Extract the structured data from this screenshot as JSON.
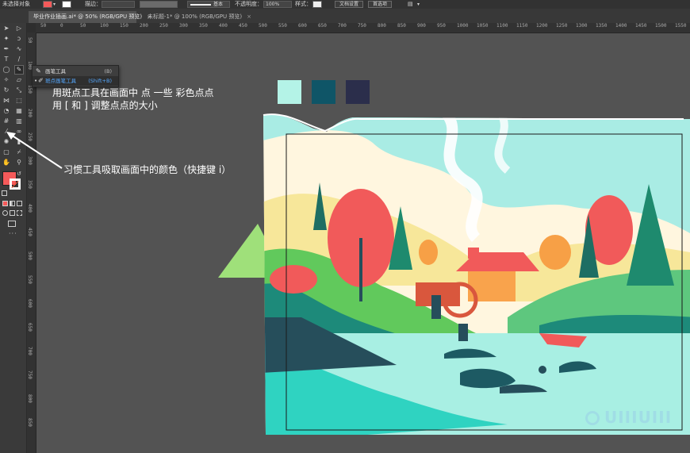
{
  "control_bar": {
    "selection_status": "未选择对象",
    "stroke_label": "描边：",
    "stroke_profile": "基本",
    "opacity_label": "不透明度：",
    "opacity_value": "100%",
    "style_label": "样式：",
    "doc_setup_button": "文档设置",
    "preferences_button": "首选项",
    "fill_color": "#f55a5a"
  },
  "tabs": [
    {
      "label": "毕业作业插画.ai* @ 50% (RGB/GPU 预览)",
      "close": "×",
      "active": true
    },
    {
      "label": "未标题-1* @ 100% (RGB/GPU 预览)",
      "close": "×",
      "active": false
    }
  ],
  "ruler": {
    "h_labels": [
      "50",
      "0",
      "50",
      "100",
      "150",
      "200",
      "250",
      "300",
      "350",
      "400",
      "450",
      "500",
      "550",
      "600",
      "650",
      "700",
      "750",
      "800",
      "850",
      "900",
      "950",
      "1000",
      "1050",
      "1100",
      "1150",
      "1200",
      "1250",
      "1300",
      "1350",
      "1400",
      "1450",
      "1500",
      "1550"
    ],
    "v_labels": [
      "50",
      "100",
      "150",
      "200",
      "250",
      "300",
      "350",
      "400",
      "450",
      "500",
      "550",
      "600",
      "650",
      "700",
      "750",
      "800",
      "850"
    ]
  },
  "flyout": {
    "items": [
      {
        "name": "画笔工具",
        "shortcut": "(B)",
        "selected": false
      },
      {
        "name": "斑点画笔工具",
        "shortcut": "(Shift+B)",
        "selected": true
      }
    ]
  },
  "annotations": {
    "line1": "用斑点工具在画面中 点 一些  彩色点点",
    "line2": "用  [    和    ]  调整点点的大小",
    "eyedropper_note": "习惯工具吸取画面中的颜色（快捷键 i）"
  },
  "swatches": [
    "#b4f3e7",
    "#0f5567",
    "#2b2e4b"
  ],
  "toolbar": {
    "fill_color": "#f55a5a",
    "stroke_color": "#ffffff",
    "icons": [
      "selection-icon",
      "direct-selection-icon",
      "magic-wand-icon",
      "lasso-icon",
      "pen-icon",
      "curvature-icon",
      "type-icon",
      "line-icon",
      "ellipse-icon",
      "brush-icon",
      "shaper-icon",
      "eraser-icon",
      "rotate-icon",
      "scale-icon",
      "width-icon",
      "free-transform-icon",
      "shape-builder-icon",
      "perspective-icon",
      "mesh-icon",
      "gradient-icon",
      "eyedropper-icon",
      "blend-icon",
      "symbol-sprayer-icon",
      "graph-icon",
      "artboard-icon",
      "slice-icon",
      "hand-icon",
      "zoom-icon"
    ]
  },
  "watermark": "UIIIUIII"
}
